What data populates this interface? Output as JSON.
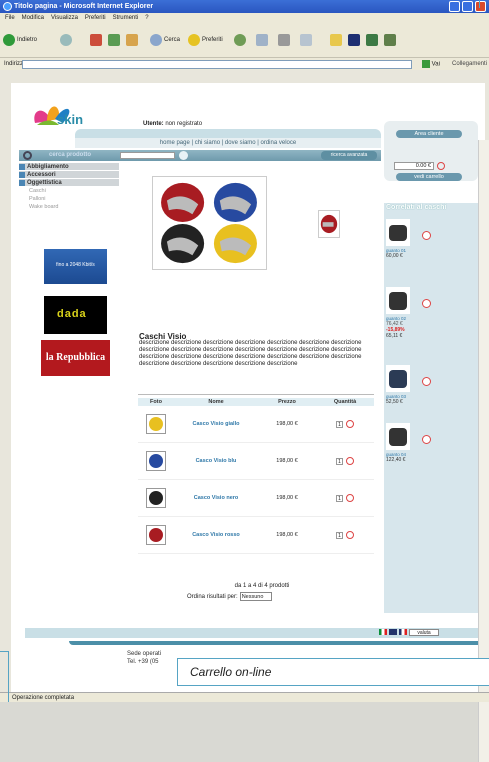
{
  "window": {
    "title": "Titolo pagina - Microsoft Internet Explorer"
  },
  "menu": [
    "File",
    "Modifica",
    "Visualizza",
    "Preferiti",
    "Strumenti",
    "?"
  ],
  "toolbar": {
    "back": "Indietro",
    "search": "Cerca",
    "favorites": "Preferiti"
  },
  "address": {
    "label": "Indirizzo",
    "go": "Vai",
    "links": "Collegamenti"
  },
  "status": "Operazione completata",
  "site": {
    "logo": "skin",
    "user_label": "Utente:",
    "user_value": "non registrato",
    "nav": "home page | chi siamo | dove siamo | ordina veloce",
    "search_label": "cerca prodotto",
    "advanced_search": "ricerca avanzata",
    "categories": [
      {
        "label": "Abbigliamento"
      },
      {
        "label": "Accessori"
      },
      {
        "label": "Oggettistica"
      }
    ],
    "subcategories": [
      "Caschi",
      "Palloni",
      "Wake board"
    ],
    "ads": {
      "speed": "fino a 2048 Kbit/s",
      "brand": "dada",
      "newspaper": "la Repubblica"
    },
    "account": {
      "area_button": "Area cliente",
      "cart_total": "0.00 €",
      "cart_button": "vedi carrello"
    },
    "product": {
      "title": "Caschi Visio",
      "description": "descrizione descrizione descrizione descrizione descrizione descrizione descrizione descrizione descrizione descrizione descrizione descrizione descrizione descrizione descrizione descrizione descrizione descrizione descrizione descrizione descrizione descrizione descrizione descrizione descrizione descrizione"
    },
    "table": {
      "headers": [
        "Foto",
        "Nome",
        "Prezzo",
        "Quantità"
      ],
      "rows": [
        {
          "name": "Casco Visio giallo",
          "price": "198,00 €",
          "qty": "1",
          "color": "#e8c020"
        },
        {
          "name": "Casco Visio blu",
          "price": "198,00 €",
          "qty": "1",
          "color": "#274aa0"
        },
        {
          "name": "Casco Visio nero",
          "price": "198,00 €",
          "qty": "1",
          "color": "#222222"
        },
        {
          "name": "Casco Visio rosso",
          "price": "198,00 €",
          "qty": "1",
          "color": "#a81c22"
        }
      ]
    },
    "pager": "da 1 a 4 di 4 prodotti",
    "sort": {
      "label": "Ordina risultati per:",
      "value": "Nessuno"
    },
    "related": {
      "title": "Correlati al caschi",
      "items": [
        {
          "name": "guanto 01",
          "price": "60,00 €"
        },
        {
          "name": "guanto 02",
          "old": "76,42 €",
          "sale": "-15,89%",
          "price": "65,11 €"
        },
        {
          "name": "guanto 03",
          "price": "52,50 €"
        },
        {
          "name": "guanto 04",
          "price": "122,40 €"
        }
      ]
    },
    "footer": {
      "valuta": "valuta",
      "line1": "Sede operati",
      "line2": "Tel. +39 (05"
    }
  },
  "caption": "Carrello on-line"
}
